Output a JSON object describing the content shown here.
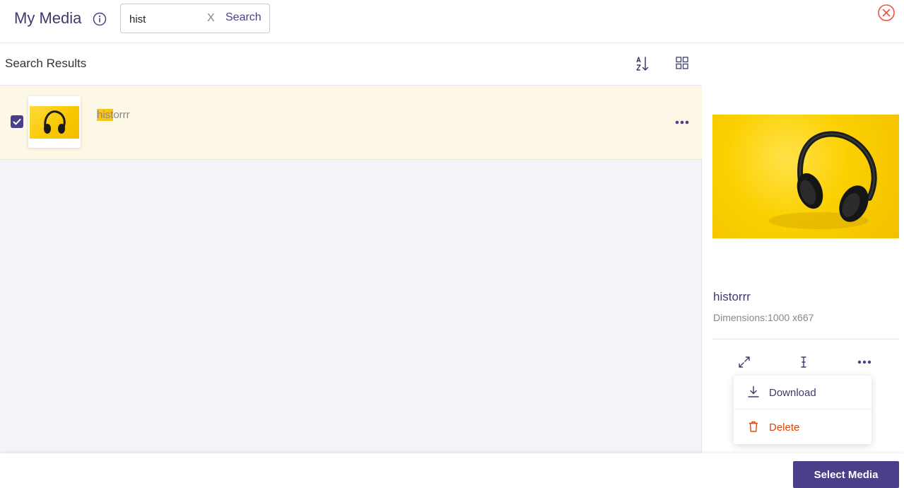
{
  "header": {
    "title": "My Media",
    "search": {
      "value": "hist",
      "clear_label": "X",
      "button_label": "Search"
    }
  },
  "results": {
    "title": "Search Results",
    "items": [
      {
        "name_highlight": "hist",
        "name_rest": "orrr",
        "selected": true
      }
    ]
  },
  "details": {
    "name": "historrr",
    "dimensions": "Dimensions:1000 x667"
  },
  "menu": {
    "download_label": "Download",
    "delete_label": "Delete"
  },
  "footer": {
    "select_label": "Select Media"
  },
  "colors": {
    "accent": "#4b3f8a",
    "danger": "#d9480f",
    "highlight": "#f5c518",
    "row_bg": "#fdf8e6"
  }
}
